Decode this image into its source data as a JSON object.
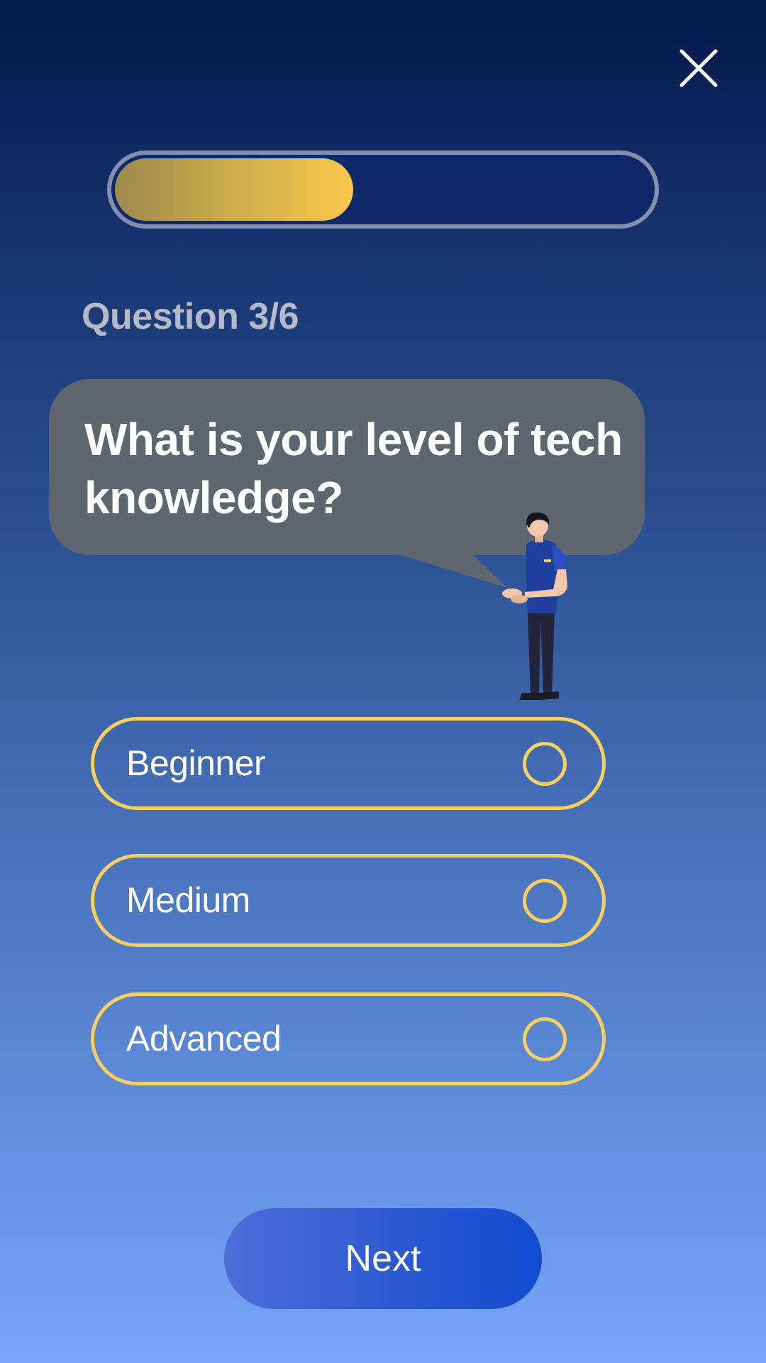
{
  "app": {
    "close_icon": "close-icon",
    "accent_color": "#f7cf5d",
    "progress_fraction": 0.5
  },
  "quiz": {
    "counter": "Question 3/6",
    "question": "What is your level of tech knowledge?",
    "options": [
      {
        "label": "Beginner",
        "selected": false
      },
      {
        "label": "Medium",
        "selected": false
      },
      {
        "label": "Advanced",
        "selected": false
      }
    ],
    "next_label": "Next"
  }
}
